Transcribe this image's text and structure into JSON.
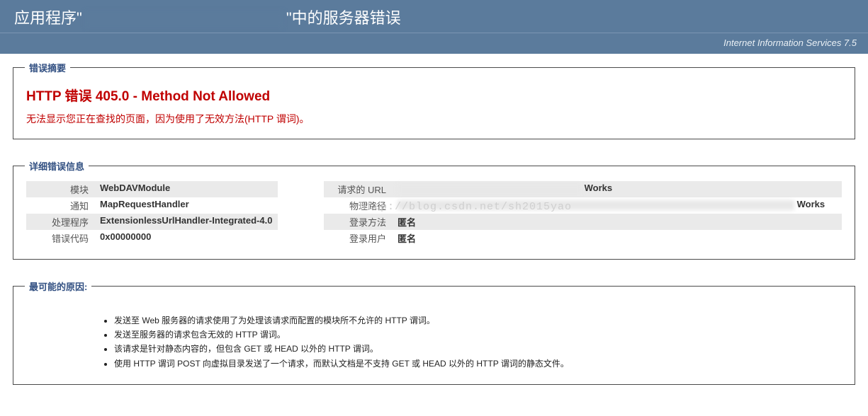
{
  "header": {
    "prefix": "应用程序\"",
    "suffix": "\"中的服务器错误",
    "subtitle": "Internet Information Services 7.5"
  },
  "summary": {
    "legend": "错误摘要",
    "title": "HTTP 错误 405.0 - Method Not Allowed",
    "subtitle": "无法显示您正在查找的页面，因为使用了无效方法(HTTP 谓词)。"
  },
  "details": {
    "legend": "详细错误信息",
    "left": [
      {
        "label": "模块",
        "value": "WebDAVModule"
      },
      {
        "label": "通知",
        "value": "MapRequestHandler"
      },
      {
        "label": "处理程序",
        "value": "ExtensionlessUrlHandler-Integrated-4.0"
      },
      {
        "label": "错误代码",
        "value": "0x00000000"
      }
    ],
    "right": [
      {
        "label": "请求的 URL",
        "value_suffix": "Works"
      },
      {
        "label": "物理路径",
        "value_suffix": "Works"
      },
      {
        "label": "登录方法",
        "value": "匿名"
      },
      {
        "label": "登录用户",
        "value": "匿名"
      }
    ]
  },
  "watermark": "http://blog.csdn.net/sh2015yao",
  "causes": {
    "legend": "最可能的原因:",
    "items": [
      "发送至 Web 服务器的请求使用了为处理该请求而配置的模块所不允许的 HTTP 谓词。",
      "发送至服务器的请求包含无效的 HTTP 谓词。",
      "该请求是针对静态内容的，但包含 GET 或 HEAD 以外的 HTTP 谓词。",
      "使用 HTTP 谓词 POST 向虚拟目录发送了一个请求，而默认文档是不支持 GET 或 HEAD 以外的 HTTP 谓词的静态文件。"
    ]
  }
}
